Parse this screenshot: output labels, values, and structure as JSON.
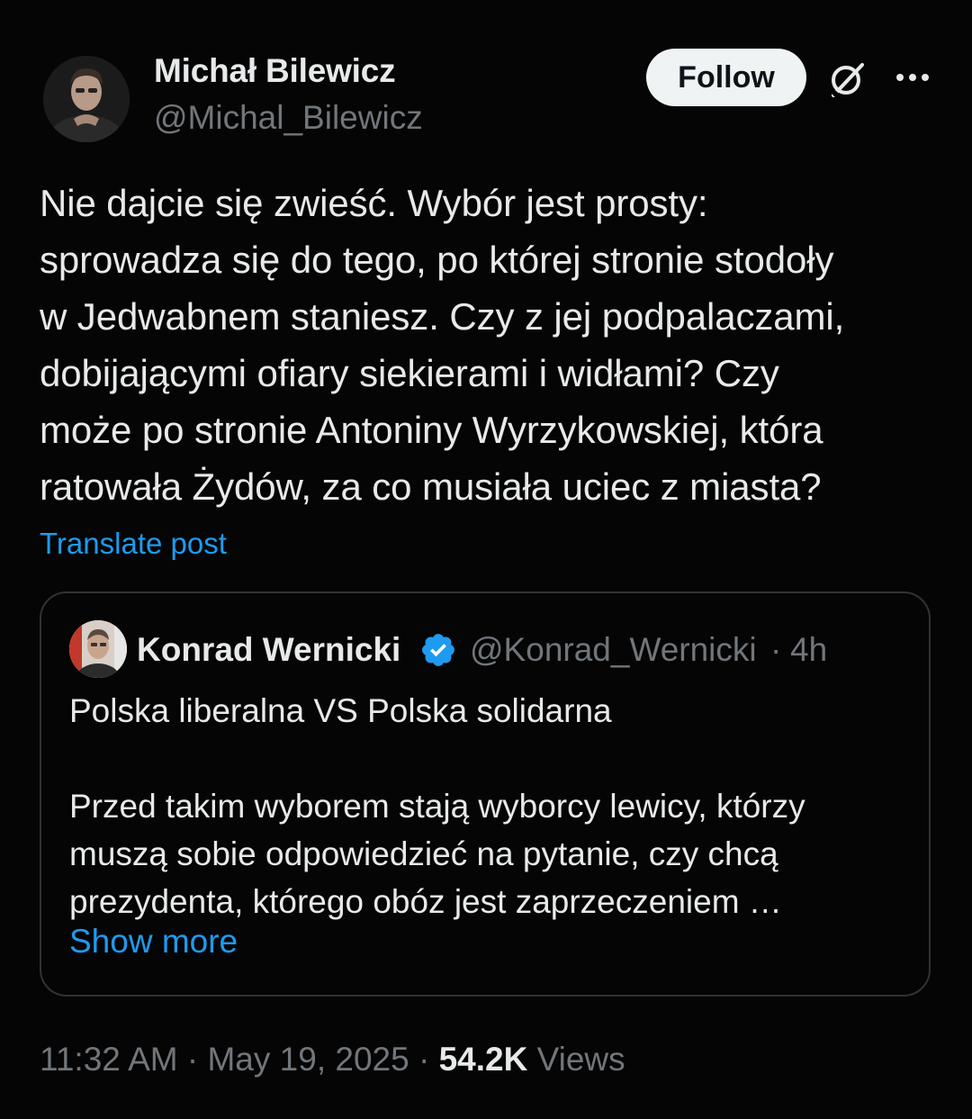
{
  "author": {
    "name": "Michał Bilewicz",
    "handle": "@Michal_Bilewicz"
  },
  "actions": {
    "follow_label": "Follow",
    "grok_icon": "grok-icon",
    "more_icon": "more-options-icon"
  },
  "post": {
    "lines": [
      "Nie dajcie się zwieść. Wybór jest prosty:",
      "sprowadza się do tego, po której stronie stodoły",
      "w Jedwabnem staniesz. Czy z jej podpalaczami,",
      "dobijającymi ofiary siekierami i widłami? Czy",
      "może po stronie Antoniny Wyrzykowskiej, która",
      "ratowała Żydów, za co musiała uciec z miasta?"
    ],
    "translate_label": "Translate post"
  },
  "quote": {
    "name": "Konrad Wernicki",
    "handle": "@Konrad_Wernicki",
    "separator": "·",
    "time": "4h",
    "headline": "Polska liberalna VS Polska solidarna",
    "body_lines": [
      "Przed takim wyborem stają wyborcy lewicy, którzy",
      "muszą sobie odpowiedzieć na pytanie, czy chcą",
      "prezydenta, którego obóz jest zaprzeczeniem …"
    ],
    "show_more": "Show more"
  },
  "meta": {
    "time": "11:32 AM",
    "separator": "·",
    "date": "May 19, 2025",
    "views_count": "54.2K",
    "views_label": "Views"
  },
  "colors": {
    "background": "#050505",
    "text": "#e7e9ea",
    "secondary": "#71767b",
    "link": "#1d9bf0",
    "border": "#2f3336",
    "verified": "#1d9bf0"
  }
}
